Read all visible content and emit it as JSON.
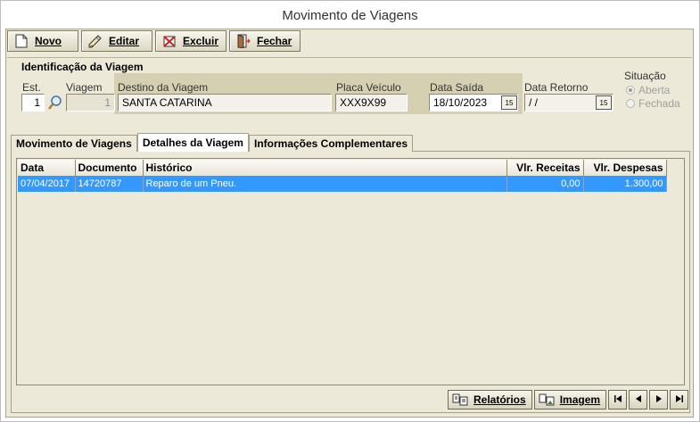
{
  "window": {
    "title": "Movimento de Viagens"
  },
  "toolbar": {
    "novo": "Novo",
    "editar": "Editar",
    "excluir": "Excluir",
    "fechar": "Fechar"
  },
  "identificacao": {
    "group_title": "Identificação da Viagem",
    "est_label": "Est.",
    "est_value": "1",
    "viagem_label": "Viagem",
    "viagem_value": "1",
    "destino_label": "Destino da Viagem",
    "destino_value": "SANTA CATARINA",
    "placa_label": "Placa Veículo",
    "placa_value": "XXX9X99",
    "saida_label": "Data Saída",
    "saida_value": "18/10/2023",
    "retorno_label": "Data Retorno",
    "retorno_value": " / /",
    "situacao_label": "Situação",
    "situacao_options": [
      "Aberta",
      "Fechada"
    ],
    "situacao_selected": "Aberta"
  },
  "tabs": [
    "Movimento de Viagens",
    "Detalhes da Viagem",
    "Informações Complementares"
  ],
  "active_tab": "Detalhes da Viagem",
  "grid": {
    "columns": [
      "Data",
      "Documento",
      "Histórico",
      "Vlr. Receitas",
      "Vlr. Despesas"
    ],
    "rows": [
      {
        "data": "07/04/2017",
        "documento": "14720787",
        "historico": "Reparo de um Pneu.",
        "receitas": "0,00",
        "despesas": "1.300,00"
      }
    ]
  },
  "bottom": {
    "relatorios": "Relatórios",
    "imagem": "Imagem"
  },
  "icons": [
    "new-document-icon",
    "edit-icon",
    "delete-icon",
    "close-door-icon",
    "search-icon",
    "calendar-icon",
    "report-icon",
    "image-icon",
    "first-icon",
    "prev-icon",
    "next-icon",
    "last-icon"
  ]
}
